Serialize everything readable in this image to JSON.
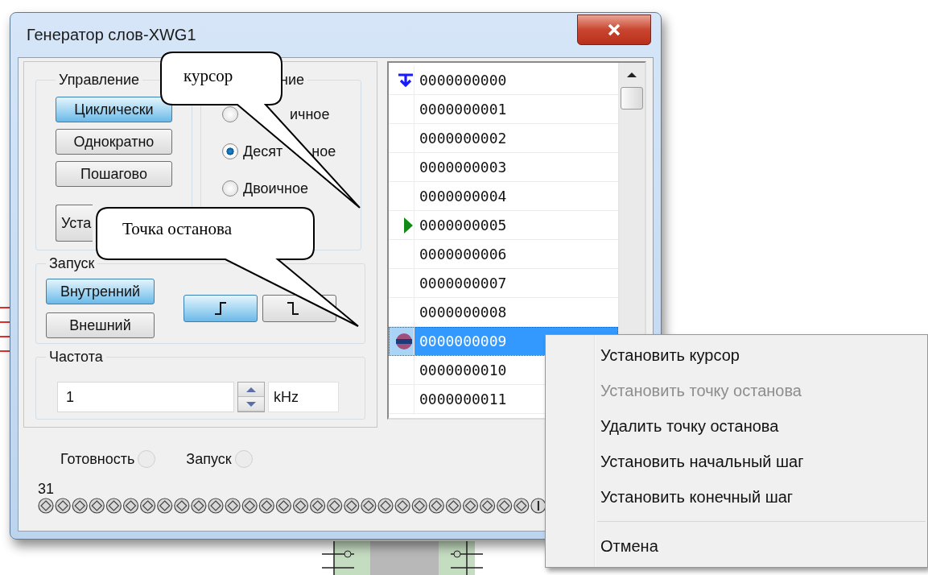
{
  "window": {
    "title": "Генератор слов-XWG1"
  },
  "control_group": {
    "title": "Управление",
    "buttons": [
      {
        "label": "Циклически",
        "selected": true
      },
      {
        "label": "Однократно",
        "selected": false
      },
      {
        "label": "Пошагово",
        "selected": false
      },
      {
        "label": "Уста",
        "selected": false
      }
    ]
  },
  "display_group": {
    "title": "ние",
    "options": [
      {
        "label_parts": [
          "ичное"
        ],
        "selected": false
      },
      {
        "label_parts": [
          "Десят",
          "ное"
        ],
        "selected": true
      },
      {
        "label_parts": [
          "Двоичное"
        ],
        "selected": false
      }
    ]
  },
  "trigger_group": {
    "title": "Запуск",
    "buttons": [
      {
        "label": "Внутренний",
        "selected": true
      },
      {
        "label": "Внешний",
        "selected": false
      }
    ],
    "edges": [
      {
        "kind": "rising",
        "selected": true
      },
      {
        "kind": "falling",
        "selected": false
      }
    ]
  },
  "frequency_group": {
    "title": "Частота",
    "value": "1",
    "unit": "kHz"
  },
  "indicators": [
    {
      "label": "Готовность",
      "on": false
    },
    {
      "label": "Запуск",
      "on": false
    }
  ],
  "pins": {
    "label": "31"
  },
  "words": [
    {
      "value": "0000000000",
      "kind": "cursor",
      "selected": false
    },
    {
      "value": "0000000001",
      "kind": "plain",
      "selected": false
    },
    {
      "value": "0000000002",
      "kind": "plain",
      "selected": false
    },
    {
      "value": "0000000003",
      "kind": "plain",
      "selected": false
    },
    {
      "value": "0000000004",
      "kind": "plain",
      "selected": false
    },
    {
      "value": "0000000005",
      "kind": "start",
      "selected": false
    },
    {
      "value": "0000000006",
      "kind": "plain",
      "selected": false
    },
    {
      "value": "0000000007",
      "kind": "plain",
      "selected": false
    },
    {
      "value": "0000000008",
      "kind": "plain",
      "selected": false
    },
    {
      "value": "0000000009",
      "kind": "breakpoint",
      "selected": true
    },
    {
      "value": "0000000010",
      "kind": "plain",
      "selected": false
    },
    {
      "value": "0000000011",
      "kind": "plain",
      "selected": false
    }
  ],
  "context_menu": [
    {
      "kind": "item",
      "label": "Установить курсор",
      "disabled": false
    },
    {
      "kind": "item",
      "label": "Установить точку останова",
      "disabled": true
    },
    {
      "kind": "item",
      "label": "Удалить точку останова",
      "disabled": false
    },
    {
      "kind": "item",
      "label": "Установить начальный шаг",
      "disabled": false
    },
    {
      "kind": "item",
      "label": "Установить конечный шаг",
      "disabled": false
    },
    {
      "kind": "separator"
    },
    {
      "kind": "item",
      "label": "Отмена",
      "disabled": false
    }
  ],
  "callouts": [
    {
      "text": "курсор"
    },
    {
      "text": "Точка останова"
    }
  ]
}
